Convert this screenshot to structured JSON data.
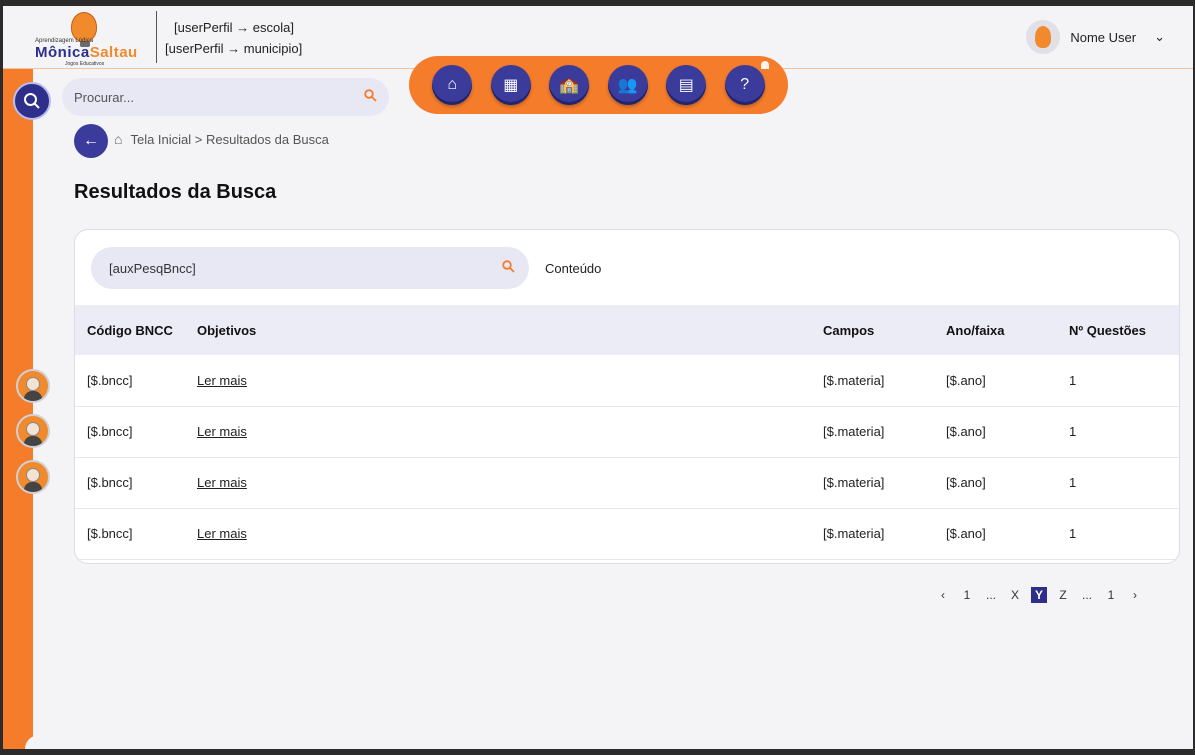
{
  "header": {
    "logo_small_top": "Aprendizagem Lúdica",
    "logo_brand_1": "Mônica",
    "logo_brand_2": "Saltau",
    "logo_small_bottom": "Jogos Educativos",
    "perfil_escola": "[userPerfil → escola]",
    "perfil_municipio": "[userPerfil → municipio]",
    "user_name": "Nome User"
  },
  "search": {
    "placeholder": "Procurar..."
  },
  "nav": {
    "items": [
      {
        "icon": "home-icon",
        "glyph": "⌂"
      },
      {
        "icon": "dashboard-icon",
        "glyph": "▦"
      },
      {
        "icon": "school-icon",
        "glyph": "🏫"
      },
      {
        "icon": "users-icon",
        "glyph": "👥"
      },
      {
        "icon": "document-icon",
        "glyph": "▤"
      },
      {
        "icon": "help-chat-icon",
        "glyph": "?"
      }
    ]
  },
  "breadcrumb": {
    "text": "Tela Inicial > Resultados da Busca"
  },
  "page": {
    "title": "Resultados da Busca"
  },
  "card": {
    "search_value": "[auxPesqBncc]",
    "filter_label": "Conteúdo"
  },
  "table": {
    "headers": [
      "Código BNCC",
      "Objetivos",
      "Campos",
      "Ano/faixa",
      "Nº Questões"
    ],
    "rows": [
      {
        "bncc": "[$.bncc]",
        "objetivos": " Ler mais",
        "campos": "[$.materia]",
        "ano": "[$.ano]",
        "questoes": "1"
      },
      {
        "bncc": "[$.bncc]",
        "objetivos": " Ler mais",
        "campos": "[$.materia]",
        "ano": "[$.ano]",
        "questoes": "1"
      },
      {
        "bncc": "[$.bncc]",
        "objetivos": " Ler mais",
        "campos": "[$.materia]",
        "ano": "[$.ano]",
        "questoes": "1"
      },
      {
        "bncc": "[$.bncc]",
        "objetivos": " Ler mais",
        "campos": "[$.materia]",
        "ano": "[$.ano]",
        "questoes": "1"
      }
    ]
  },
  "pagination": {
    "prev": "‹",
    "items": [
      "1",
      "...",
      "X",
      "Y",
      "Z",
      "...",
      "1"
    ],
    "active_index": 3,
    "next": "›"
  },
  "colors": {
    "accent": "#f57c2a",
    "primary": "#2e2f8a"
  }
}
